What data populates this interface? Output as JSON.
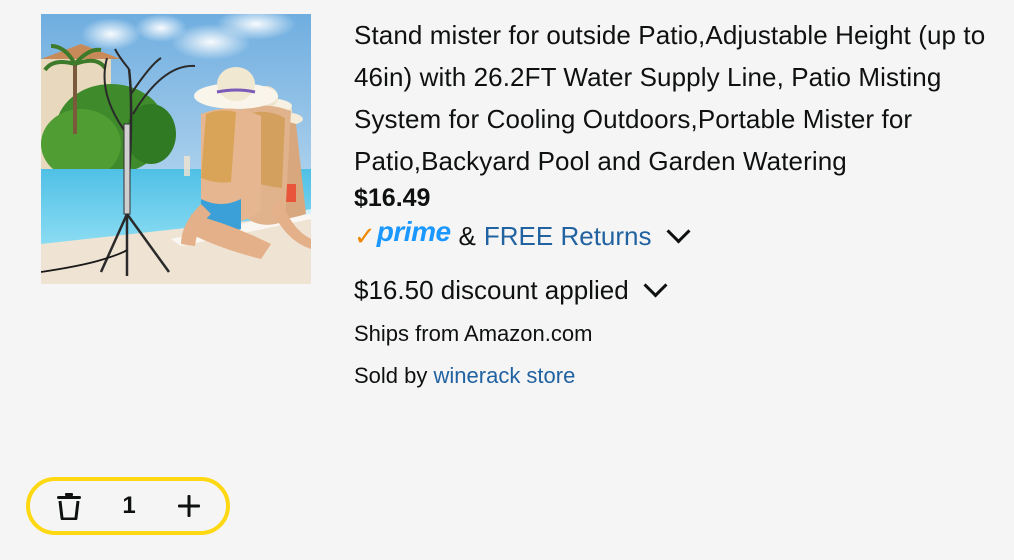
{
  "product": {
    "image_alt": "Stand mister product photo",
    "title": "Stand mister for outside Patio,Adjustable Height (up to 46in) with 26.2FT Water Supply Line, Patio Misting System for Cooling Outdoors,Portable Mister for Patio,Backyard Pool and Garden Watering",
    "price": "$16.49"
  },
  "delivery": {
    "prime_check": "✓",
    "prime_label": "prime",
    "amp": "&",
    "returns_label": "FREE Returns",
    "chevron_icon": "chevron-down-icon"
  },
  "discount": {
    "text": "$16.50 discount applied",
    "chevron_icon": "chevron-down-icon"
  },
  "fulfillment": {
    "ships_from": "Ships from Amazon.com",
    "sold_by_prefix": "Sold by",
    "seller_name": "winerack store"
  },
  "quantity": {
    "value": "1",
    "delete_icon": "trash-icon",
    "increment_icon": "plus-icon"
  },
  "colors": {
    "link": "#2162a1",
    "prime_blue": "#1a98ff",
    "prime_check": "#f08804",
    "stepper_border": "#ffd814",
    "background": "#f5f5f5"
  }
}
